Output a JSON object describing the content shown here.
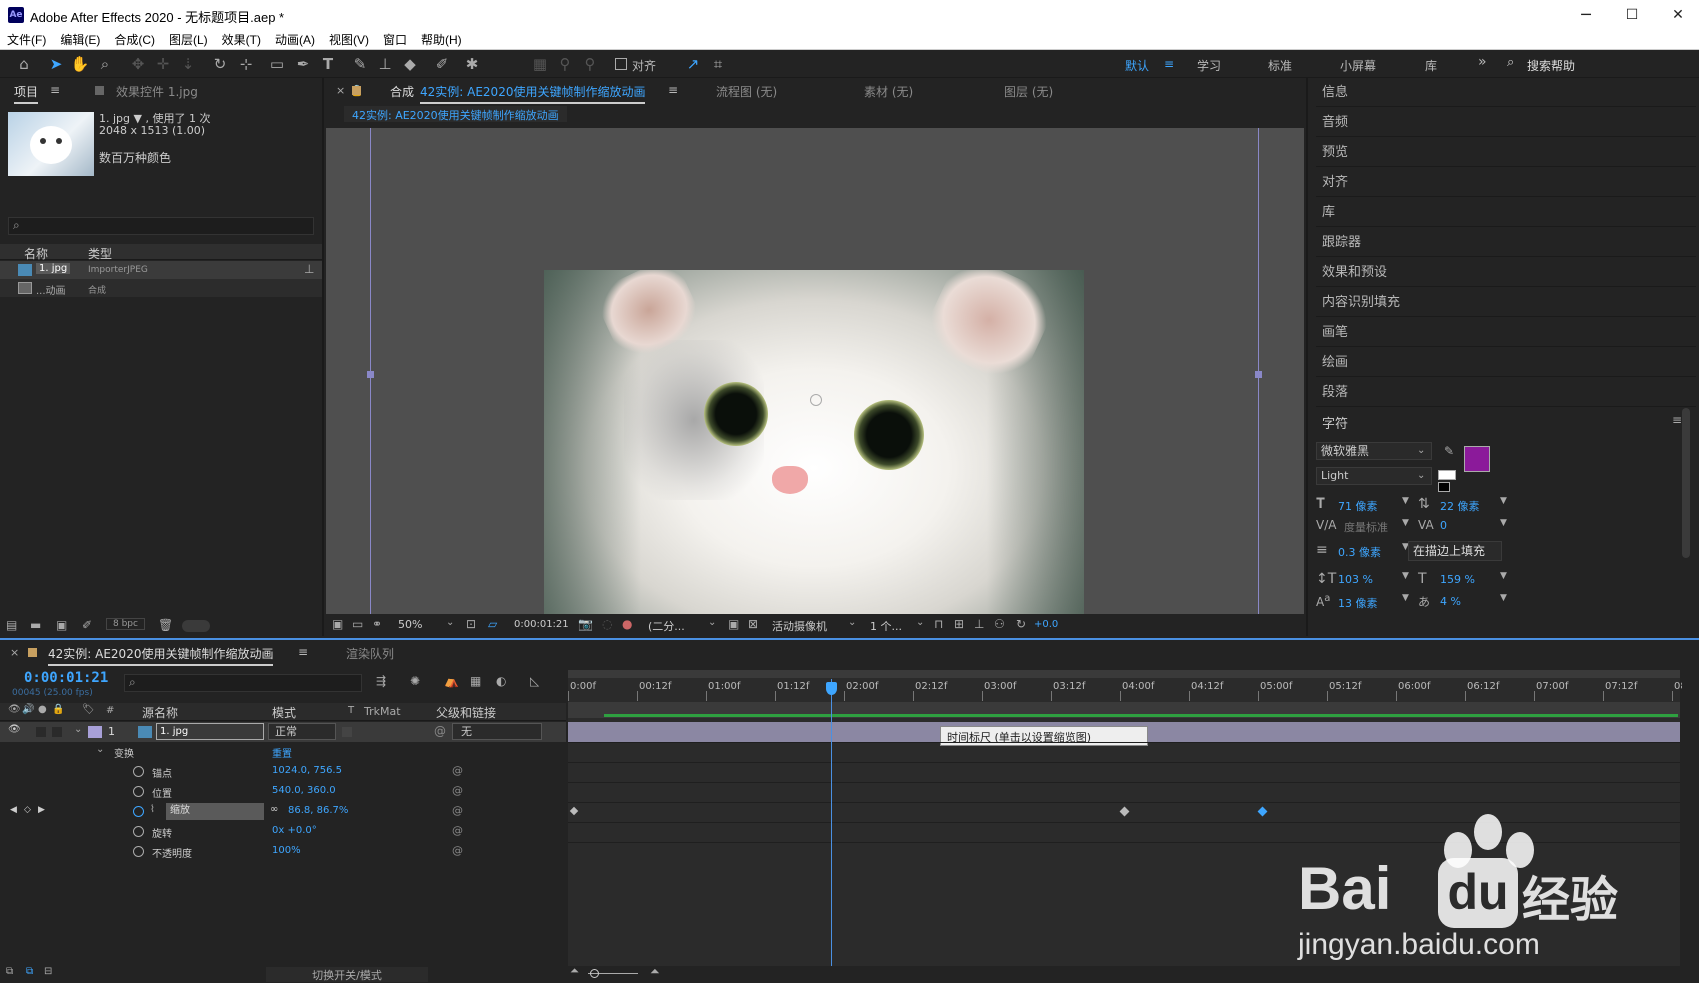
{
  "window": {
    "title": "Adobe After Effects 2020 - 无标题项目.aep *",
    "logo": "Ae",
    "minimize": "─",
    "maximize": "☐",
    "close": "✕"
  },
  "menu": [
    "文件(F)",
    "编辑(E)",
    "合成(C)",
    "图层(L)",
    "效果(T)",
    "动画(A)",
    "视图(V)",
    "窗口",
    "帮助(H)"
  ],
  "toolbar": {
    "align_label": "对齐",
    "workspaces": [
      "默认",
      "学习",
      "标准",
      "小屏幕",
      "库"
    ],
    "more": "»",
    "search_placeholder": "搜索帮助"
  },
  "project_panel": {
    "tab_project": "项目",
    "tab_effects": "效果控件 1.jpg",
    "file_name": "1. jpg ▼ , 使用了 1 次",
    "file_dims": "2048 x 1513 (1.00)",
    "file_colors": "数百万种颜色",
    "col_name": "名称",
    "col_type": "类型",
    "items": [
      {
        "name": "1. jpg",
        "type": "ImporterJPEG"
      },
      {
        "name": "...动画",
        "type": "合成"
      }
    ],
    "bpc": "8 bpc"
  },
  "composition_panel": {
    "tab_comp": "合成",
    "tab_comp_name": "42实例: AE2020使用关键帧制作缩放动画",
    "tab_flow": "流程图 (无)",
    "tab_footage": "素材 (无)",
    "tab_layer": "图层 (无)",
    "breadcrumb": "42实例: AE2020使用关键帧制作缩放动画",
    "zoom": "50%",
    "timecode": "0:00:01:21",
    "resolution": "(二分...",
    "camera": "活动摄像机",
    "views": "1 个...",
    "exposure": "+0.0"
  },
  "right_panels": [
    "信息",
    "音频",
    "预览",
    "对齐",
    "库",
    "跟踪器",
    "效果和预设",
    "内容识别填充",
    "画笔",
    "绘画",
    "段落"
  ],
  "character": {
    "title": "字符",
    "font": "微软雅黑",
    "style": "Light",
    "size": "71 像素",
    "leading": "22 像素",
    "kerning": "度量标准",
    "tracking": "0",
    "stroke_width": "0.3 像素",
    "stroke_mode": "在描边上填充",
    "vscale": "103 %",
    "hscale": "159 %",
    "baseline": "13 像素",
    "tsume": "4 %",
    "fill_color": "#8b1a9a"
  },
  "timeline": {
    "tab_comp": "42实例: AE2020使用关键帧制作缩放动画",
    "tab_render": "渲染队列",
    "current_time": "0:00:01:21",
    "frame_info": "00045 (25.00 fps)",
    "col_hash": "#",
    "col_source": "源名称",
    "col_mode": "模式",
    "col_t": "T",
    "col_trkmat": "TrkMat",
    "col_parent": "父级和链接",
    "layer_num": "1",
    "layer_name": "1. jpg",
    "layer_mode": "正常",
    "layer_parent": "无",
    "transform_label": "变换",
    "transform_reset": "重置",
    "properties": [
      {
        "name": "锚点",
        "value": "1024.0, 756.5"
      },
      {
        "name": "位置",
        "value": "540.0, 360.0"
      },
      {
        "name": "缩放",
        "value": "86.8, 86.7%"
      },
      {
        "name": "旋转",
        "value": "0x +0.0°"
      },
      {
        "name": "不透明度",
        "value": "100%"
      }
    ],
    "ruler_labels": [
      "0:00f",
      "00:12f",
      "01:00f",
      "01:12f",
      "02:00f",
      "02:12f",
      "03:00f",
      "03:12f",
      "04:00f",
      "04:12f",
      "05:00f",
      "05:12f",
      "06:00f",
      "06:12f",
      "07:00f",
      "07:12f",
      "08:0"
    ],
    "tooltip": "时间标尺 (单击以设置缩览图)",
    "toggle_label": "切换开关/模式"
  },
  "watermark": {
    "brand": "Bai",
    "brand2": "du",
    "brand3": "经验",
    "url": "jingyan.baidu.com"
  }
}
